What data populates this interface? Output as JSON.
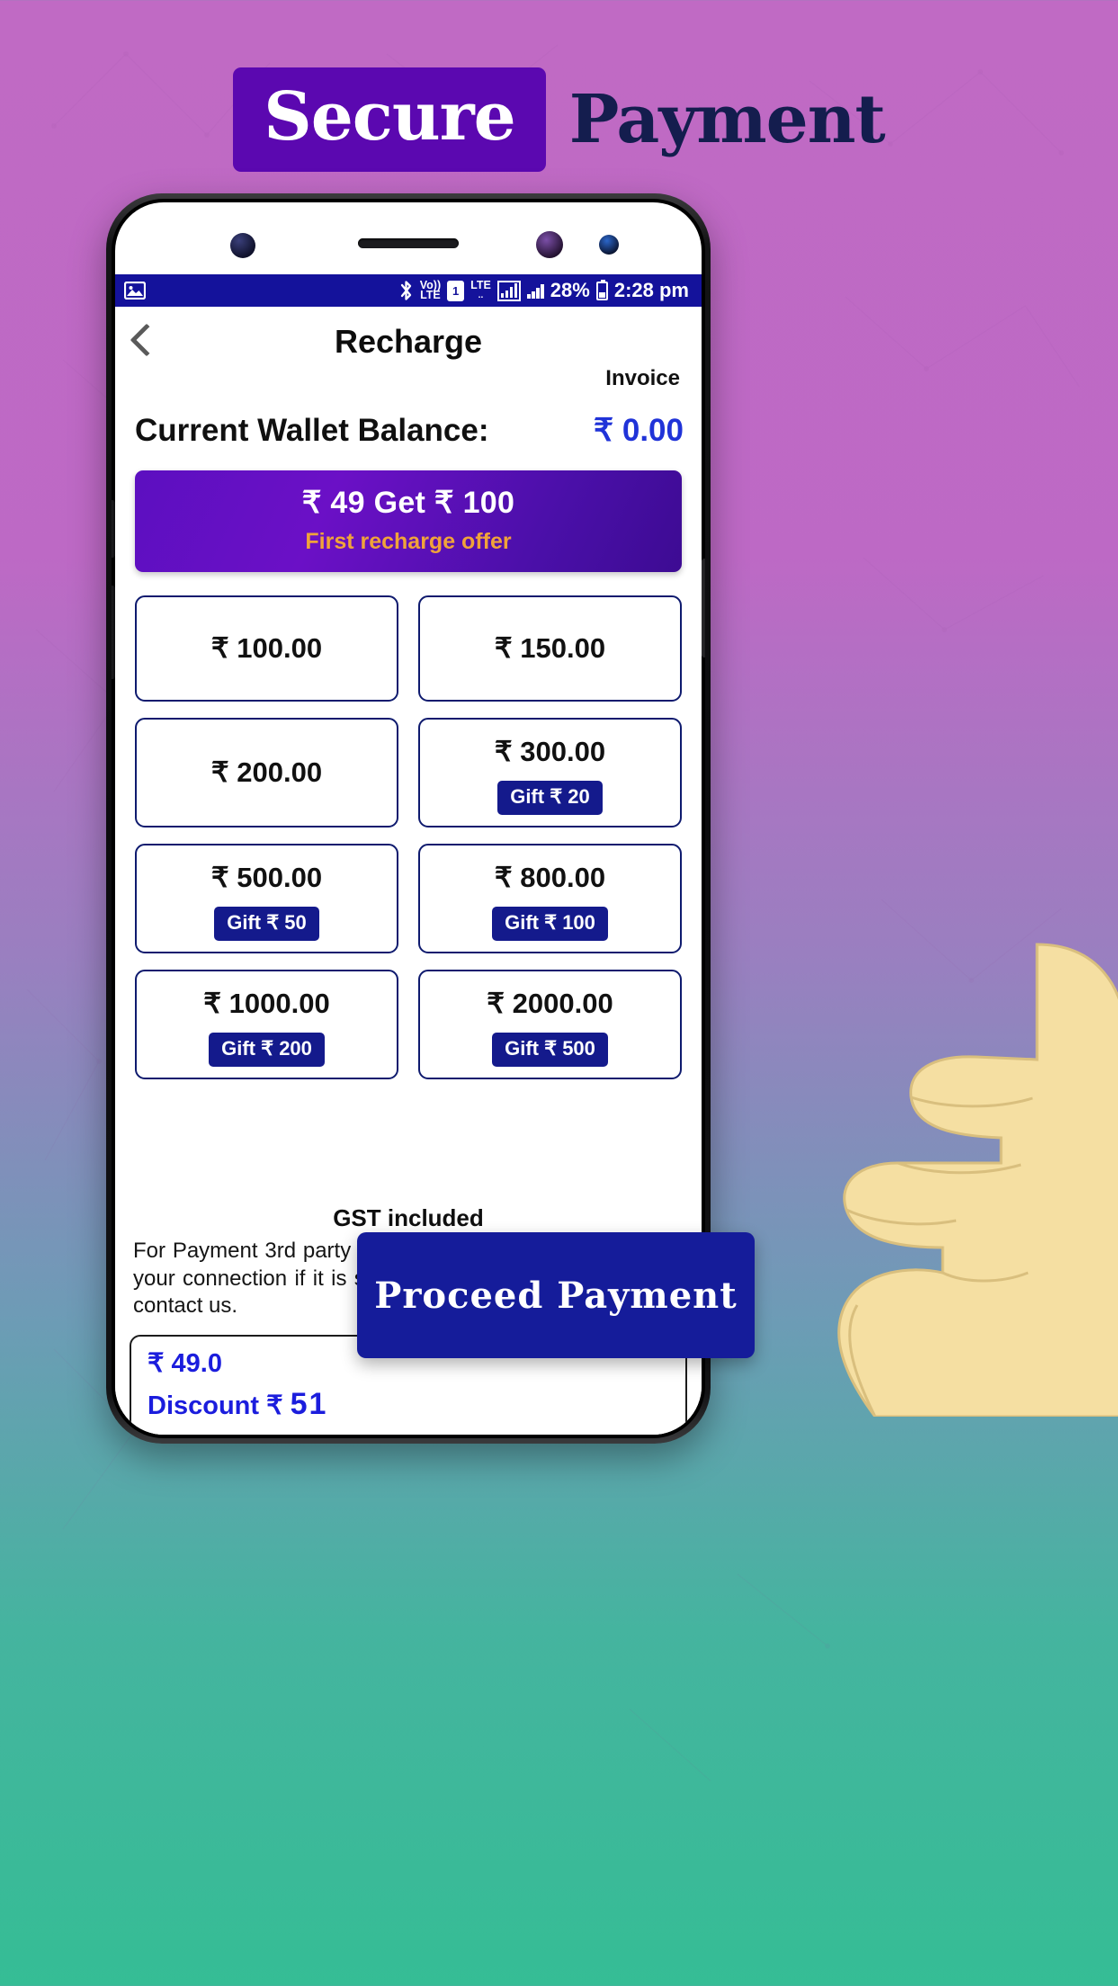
{
  "headline": {
    "word1": "Secure",
    "word2": "Payment",
    "badge_color": "#5b08b0",
    "word2_color": "#141d4e"
  },
  "status_bar": {
    "gallery_icon": "image-icon",
    "bluetooth_icon": "bluetooth-icon",
    "volte_line1": "Vo))",
    "volte_line2": "LTE",
    "sim_number": "1",
    "lte_line1": "LTE",
    "lte_line2": "..",
    "battery_percent": "28%",
    "time": "2:28 pm"
  },
  "appbar": {
    "back_icon": "back-chevron-icon",
    "title": "Recharge",
    "invoice": "Invoice"
  },
  "wallet": {
    "label": "Current Wallet Balance:",
    "value": "₹ 0.00",
    "value_color": "#2033d8"
  },
  "offer": {
    "title": "₹ 49 Get ₹ 100",
    "subtitle": "First recharge offer",
    "subtitle_color": "#f0a33a"
  },
  "amounts": [
    {
      "value": "₹ 100.00",
      "gift": ""
    },
    {
      "value": "₹ 150.00",
      "gift": ""
    },
    {
      "value": "₹ 200.00",
      "gift": ""
    },
    {
      "value": "₹ 300.00",
      "gift": "Gift ₹ 20"
    },
    {
      "value": "₹ 500.00",
      "gift": "Gift ₹ 50"
    },
    {
      "value": "₹ 800.00",
      "gift": "Gift ₹ 100"
    },
    {
      "value": "₹ 1000.00",
      "gift": "Gift ₹ 200"
    },
    {
      "value": "₹ 2000.00",
      "gift": "Gift ₹ 500"
    }
  ],
  "footer": {
    "gst": "GST included",
    "disclaimer": "For Payment 3rd party services going to be use. Refresh your connection if it is slow. If you face any issue please contact us.",
    "support_icon": "support-agent-icon"
  },
  "bottom_bar": {
    "amount": "₹ 49.0",
    "discount_label": "Discount ₹",
    "discount_value": "51"
  },
  "cta": {
    "label": "Proceed  Payment",
    "color": "#151c9a"
  }
}
